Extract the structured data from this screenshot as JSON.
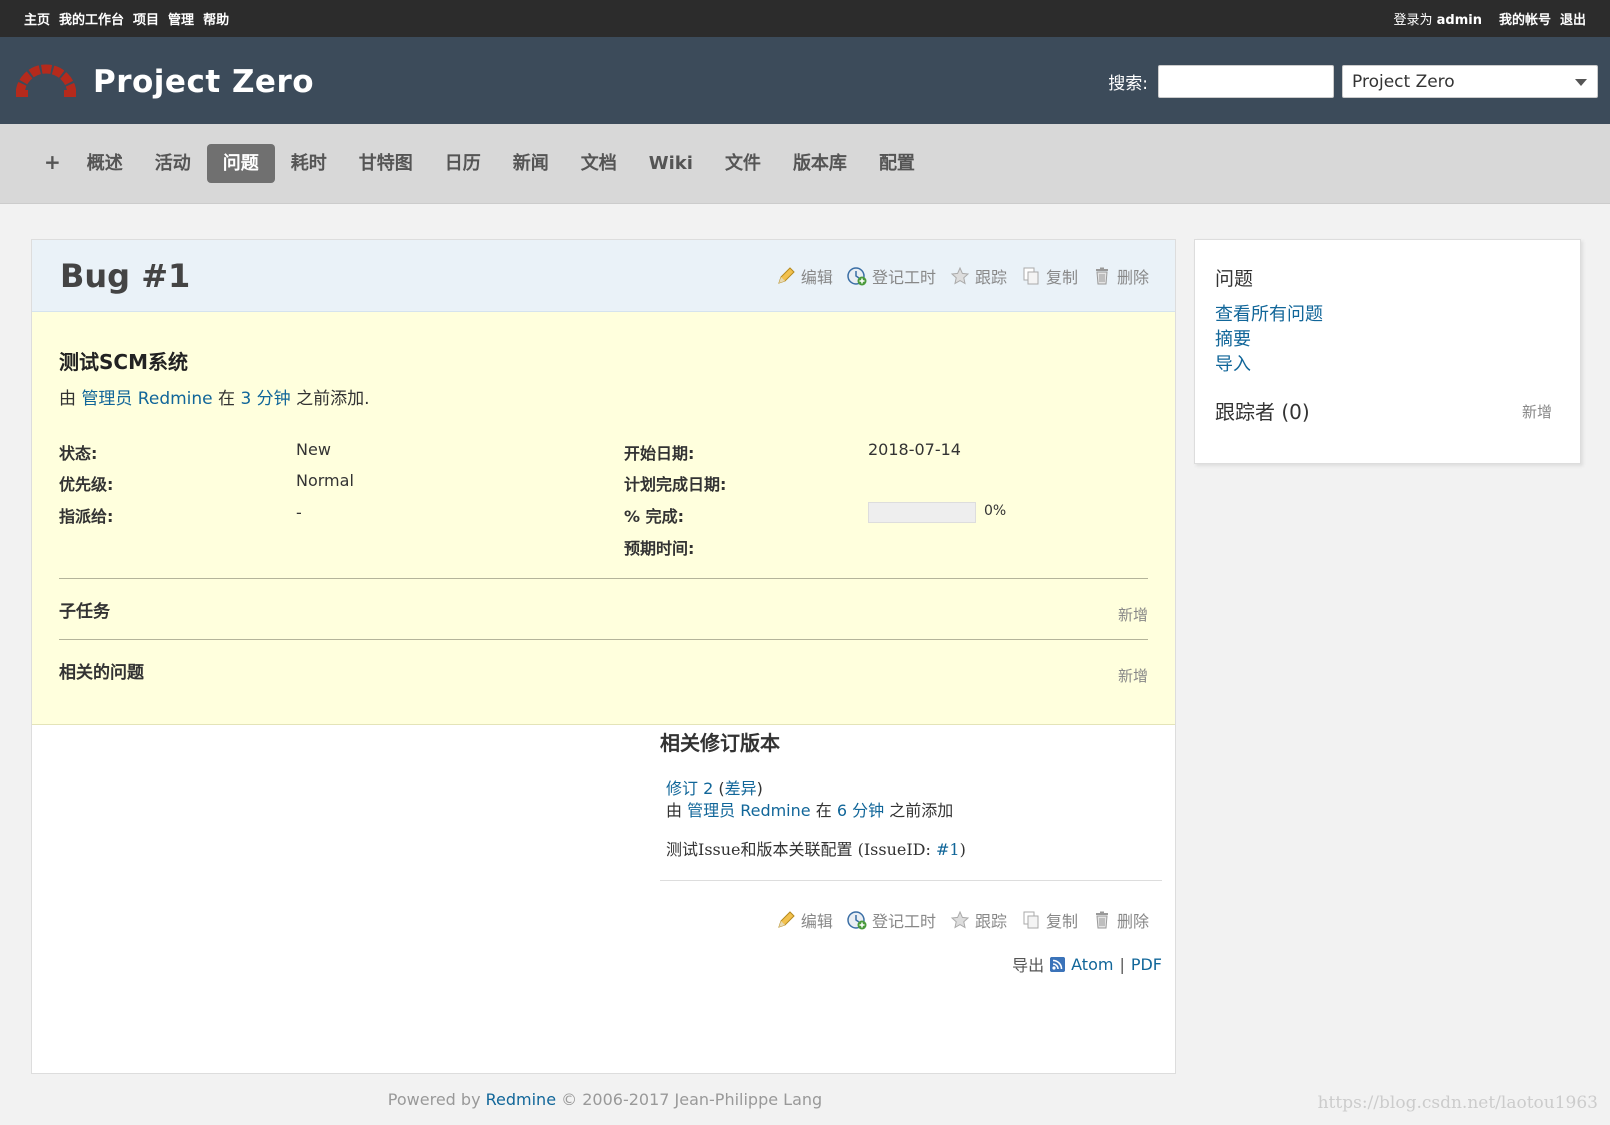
{
  "top_menu": {
    "left_items": [
      "主页",
      "我的工作台",
      "项目",
      "管理",
      "帮助"
    ],
    "logged_as_prefix": "登录为",
    "logged_as_user": "admin",
    "my_account": "我的帐号",
    "logout": "退出"
  },
  "header": {
    "project_title": "Project Zero",
    "search_label": "搜索:",
    "search_value": "",
    "project_select_value": "Project Zero"
  },
  "main_menu": {
    "plus": "+",
    "tabs": [
      "概述",
      "活动",
      "问题",
      "耗时",
      "甘特图",
      "日历",
      "新闻",
      "文档",
      "Wiki",
      "文件",
      "版本库",
      "配置"
    ],
    "selected": "问题"
  },
  "issue": {
    "title": "Bug #1",
    "actions": {
      "edit": "编辑",
      "log_time": "登记工时",
      "watch": "跟踪",
      "copy": "复制",
      "delete": "删除"
    },
    "subject": "测试SCM系统",
    "author_prefix": "由",
    "author_name": "管理员 Redmine",
    "author_mid": "在",
    "author_time": "3 分钟",
    "author_suffix": "之前添加.",
    "attributes": {
      "status_label": "状态:",
      "status_value": "New",
      "priority_label": "优先级:",
      "priority_value": "Normal",
      "assignee_label": "指派给:",
      "assignee_value": "-",
      "start_date_label": "开始日期:",
      "start_date_value": "2018-07-14",
      "due_date_label": "计划完成日期:",
      "due_date_value": "",
      "done_label": "% 完成:",
      "done_ratio": 0,
      "done_text": "0%",
      "estimated_label": "预期时间:",
      "estimated_value": ""
    },
    "subtasks_title": "子任务",
    "subtasks_add": "新增",
    "relations_title": "相关的问题",
    "relations_add": "新增"
  },
  "changesets": {
    "title": "相关修订版本",
    "revision_link": "修订 2",
    "diff_link": "差异",
    "author_prefix": "由",
    "author_name": "管理员 Redmine",
    "author_mid": "在",
    "author_time": "6 分钟",
    "author_suffix": "之前添加",
    "comment_prefix": "测试Issue和版本关联配置 (IssueID: ",
    "comment_link": "#1",
    "comment_suffix": ")"
  },
  "export": {
    "label": "导出",
    "atom": "Atom",
    "separator": "|",
    "pdf": "PDF"
  },
  "sidebar": {
    "title": "问题",
    "links": [
      "查看所有问题",
      "摘要",
      "导入"
    ],
    "watchers": "跟踪者 (0)",
    "watchers_add": "新增"
  },
  "footer": {
    "prefix": "Powered by",
    "link": "Redmine",
    "suffix": "© 2006-2017 Jean-Philippe Lang"
  },
  "watermark": "https://blog.csdn.net/laotou1963",
  "colors": {
    "top_menu_bg": "#2c2c2c",
    "header_bg": "#3c4b5a",
    "issue_bg": "#ffffdd",
    "link": "#1166aa",
    "selected_tab": "#707070"
  }
}
